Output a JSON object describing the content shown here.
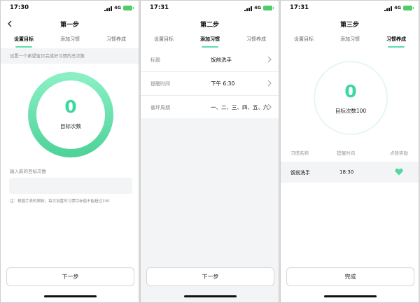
{
  "status": {
    "network": "4G"
  },
  "screens": [
    {
      "time": "17:30",
      "title": "第一步",
      "tabs": [
        "设置目标",
        "添加习惯",
        "习惯养成"
      ],
      "hint": "设置一个希望宝贝完成好习惯的总次数",
      "target_count": "0",
      "target_label": "目标次数",
      "input_label": "输入新的目标次数",
      "input_placeholder": "",
      "note": "注：根据手表的限制，每次设置的习惯目标值不能超过100",
      "button": "下一步"
    },
    {
      "time": "17:31",
      "title": "第二步",
      "tabs": [
        "设置目标",
        "添加习惯",
        "习惯养成"
      ],
      "fields": [
        {
          "key": "标题",
          "value": "饭前洗手"
        },
        {
          "key": "提醒时间",
          "value": "下午 6:30"
        },
        {
          "key": "循环周期",
          "value": "一、二、三、四、五、六"
        }
      ],
      "button": "下一步"
    },
    {
      "time": "17:31",
      "title": "第三步",
      "tabs": [
        "设置目标",
        "添加习惯",
        "习惯养成"
      ],
      "count": "0",
      "count_label": "目标次数100",
      "headers": [
        "习惯名称",
        "提醒时间",
        "点赞奖励"
      ],
      "row": {
        "name": "饭前洗手",
        "time": "18:30"
      },
      "button": "完成"
    }
  ],
  "colors": {
    "accent": "#5fdcaa",
    "heart": "#52d9a0",
    "battery": "#52cc6a"
  }
}
